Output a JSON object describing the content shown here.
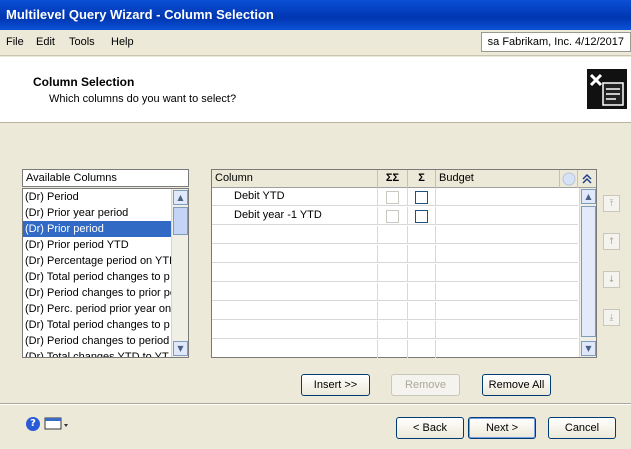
{
  "window": {
    "title": "Multilevel Query Wizard - Column Selection"
  },
  "menu": {
    "items": [
      "File",
      "Edit",
      "Tools",
      "Help"
    ],
    "user_info": "sa  Fabrikam, Inc.  4/12/2017"
  },
  "header": {
    "title": "Column Selection",
    "subtitle": "Which columns do you want to select?"
  },
  "available": {
    "label": "Available Columns",
    "items": [
      "(Dr) Period",
      "(Dr) Prior year period",
      "(Dr) Prior period",
      "(Dr) Prior period YTD",
      "(Dr) Percentage period on YTD",
      "(Dr) Total period changes to p",
      "(Dr) Period changes to prior pe",
      "(Dr) Perc. period prior year on",
      "(Dr) Total period changes to p",
      "(Dr) Period changes to period",
      "(Dr) Total changes YTD to YT"
    ],
    "selected_index": 2
  },
  "grid": {
    "headers": {
      "column": "Column",
      "sigma_sigma": "ΣΣ",
      "sigma": "Σ",
      "budget": "Budget"
    },
    "rows": [
      {
        "column": "Debit YTD",
        "budget": ""
      },
      {
        "column": "Debit year -1 YTD",
        "budget": ""
      }
    ]
  },
  "buttons": {
    "insert": "Insert >>",
    "remove": "Remove",
    "remove_all": "Remove All",
    "back": "< Back",
    "next": "Next >",
    "cancel": "Cancel"
  },
  "icons": {
    "help": "help-icon",
    "note": "note-icon",
    "logo": "wizard-logo-icon"
  },
  "colors": {
    "titlebar": "#0a4fd6",
    "selection": "#316ac5"
  }
}
